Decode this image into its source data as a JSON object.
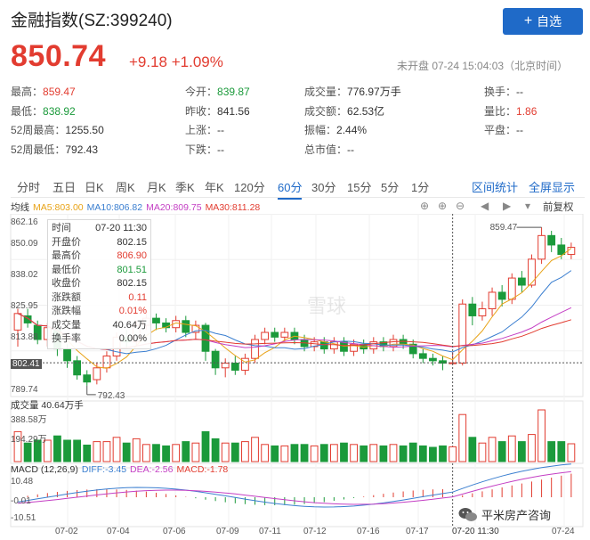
{
  "header": {
    "title": "金融指数(SZ:399240)",
    "add_button": "自选",
    "price": "850.74",
    "change": "+9.18 +1.09%",
    "status": "未开盘 07-24 15:04:03（北京时间）"
  },
  "stats": [
    [
      {
        "label": "最高：",
        "value": "859.47",
        "tone": "up"
      },
      {
        "label": "今开：",
        "value": "839.87",
        "tone": "down"
      },
      {
        "label": "成交量：",
        "value": "776.97万手",
        "tone": ""
      },
      {
        "label": "换手：",
        "value": "--",
        "tone": ""
      }
    ],
    [
      {
        "label": "最低：",
        "value": "838.92",
        "tone": "down"
      },
      {
        "label": "昨收：",
        "value": "841.56",
        "tone": ""
      },
      {
        "label": "成交额：",
        "value": "62.53亿",
        "tone": ""
      },
      {
        "label": "量比：",
        "value": "1.86",
        "tone": "up"
      }
    ],
    [
      {
        "label": "52周最高：",
        "value": "1255.50",
        "tone": ""
      },
      {
        "label": "上涨：",
        "value": "--",
        "tone": ""
      },
      {
        "label": "振幅：",
        "value": "2.44%",
        "tone": ""
      },
      {
        "label": "平盘：",
        "value": "--",
        "tone": ""
      }
    ],
    [
      {
        "label": "52周最低：",
        "value": "792.43",
        "tone": ""
      },
      {
        "label": "下跌：",
        "value": "--",
        "tone": ""
      },
      {
        "label": "总市值：",
        "value": "--",
        "tone": ""
      },
      {
        "label": "",
        "value": "",
        "tone": ""
      }
    ]
  ],
  "tabs": [
    "分时",
    "五日",
    "日K",
    "周K",
    "月K",
    "季K",
    "年K",
    "120分",
    "60分",
    "30分",
    "15分",
    "5分",
    "1分"
  ],
  "active_tab": "60分",
  "tab_links": [
    "区间统计",
    "全屏显示"
  ],
  "ma_legend": [
    {
      "text": "均线",
      "color": "#333333"
    },
    {
      "text": "MA5:803.00",
      "color": "#e8a317"
    },
    {
      "text": "MA10:806.82",
      "color": "#3b7fd0"
    },
    {
      "text": "MA20:809.75",
      "color": "#c43fc4"
    },
    {
      "text": "MA30:811.28",
      "color": "#e23c30"
    }
  ],
  "restore_label": "前复权",
  "tooltip": [
    {
      "k": "时间",
      "v": "07-20 11:30",
      "tone": ""
    },
    {
      "k": "开盘价",
      "v": "802.15",
      "tone": ""
    },
    {
      "k": "最高价",
      "v": "806.90",
      "tone": "up"
    },
    {
      "k": "最低价",
      "v": "801.51",
      "tone": "down"
    },
    {
      "k": "收盘价",
      "v": "802.15",
      "tone": ""
    },
    {
      "k": "涨跌额",
      "v": "0.11",
      "tone": "up"
    },
    {
      "k": "涨跌幅",
      "v": "0.01%",
      "tone": "up"
    },
    {
      "k": "成交量",
      "v": "40.64万",
      "tone": ""
    },
    {
      "k": "换手率",
      "v": "0.00%",
      "tone": ""
    }
  ],
  "watermark": "雪球",
  "price_axis": [
    "862.16",
    "850.09",
    "838.02",
    "825.95",
    "813.88",
    "802.41",
    "789.74"
  ],
  "annotations": {
    "high": "859.47",
    "low": "792.43"
  },
  "volume": {
    "label": "成交量 40.64万手",
    "axis": [
      "388.58万",
      "194.29万"
    ]
  },
  "macd": {
    "legend": [
      {
        "text": "MACD (12,26,9)",
        "color": "#333333"
      },
      {
        "text": "DIFF:-3.45",
        "color": "#3b7fd0"
      },
      {
        "text": "DEA:-2.56",
        "color": "#c43fc4"
      },
      {
        "text": "MACD:-1.78",
        "color": "#e23c30"
      }
    ],
    "axis": [
      "10.48",
      "-0.01",
      "-10.51"
    ]
  },
  "x_labels": [
    "07-02",
    "07-04",
    "07-06",
    "07-09",
    "07-11",
    "07-12",
    "07-16",
    "07-17",
    "07-20 11:30",
    "07-24"
  ],
  "wechat_label": "平米房产咨询",
  "colors": {
    "up": "#e23c30",
    "down": "#1b9a3b",
    "accent": "#1f6ac8"
  },
  "chart_data": {
    "type": "candlestick",
    "y_range": [
      789.74,
      862.16
    ],
    "candles": [
      [
        816,
        823,
        809,
        825
      ],
      [
        822,
        819,
        817,
        825
      ],
      [
        818,
        812,
        810,
        820
      ],
      [
        812,
        817,
        809,
        819
      ],
      [
        816,
        808,
        805,
        818
      ],
      [
        808,
        803,
        800,
        810
      ],
      [
        803,
        797,
        795,
        805
      ],
      [
        797,
        794,
        792.43,
        799
      ],
      [
        795,
        800,
        793,
        802
      ],
      [
        800,
        805,
        798,
        807
      ],
      [
        805,
        813,
        803,
        815
      ],
      [
        813,
        811,
        808,
        816
      ],
      [
        811,
        818,
        809,
        820
      ],
      [
        818,
        821,
        816,
        823
      ],
      [
        821,
        819,
        816,
        823
      ],
      [
        819,
        817,
        815,
        821
      ],
      [
        817,
        820,
        815,
        822
      ],
      [
        820,
        815,
        813,
        822
      ],
      [
        815,
        818,
        812,
        820
      ],
      [
        818,
        807,
        803,
        819
      ],
      [
        807,
        800,
        797,
        808
      ],
      [
        800,
        802,
        796,
        804
      ],
      [
        802,
        799,
        797,
        805
      ],
      [
        799,
        804,
        797,
        806
      ],
      [
        804,
        812,
        802,
        814
      ],
      [
        812,
        815,
        810,
        817
      ],
      [
        815,
        813,
        811,
        817
      ],
      [
        813,
        815,
        811,
        817
      ],
      [
        815,
        812,
        810,
        817
      ],
      [
        812,
        809,
        807,
        814
      ],
      [
        809,
        811,
        807,
        813
      ],
      [
        811,
        808,
        806,
        813
      ],
      [
        808,
        811,
        806,
        813
      ],
      [
        811,
        807,
        805,
        813
      ],
      [
        807,
        810,
        805,
        812
      ],
      [
        810,
        808,
        806,
        812
      ],
      [
        808,
        811,
        806,
        813
      ],
      [
        811,
        809,
        807,
        813
      ],
      [
        809,
        812,
        807,
        814
      ],
      [
        812,
        810,
        808,
        814
      ],
      [
        810,
        806,
        804,
        812
      ],
      [
        806,
        804,
        802,
        808
      ],
      [
        804,
        803,
        801,
        806
      ],
      [
        803,
        802,
        799,
        805
      ],
      [
        802.15,
        802.15,
        801.51,
        806.9
      ],
      [
        802,
        827,
        801,
        829
      ],
      [
        827,
        822,
        818,
        830
      ],
      [
        822,
        825,
        820,
        828
      ],
      [
        825,
        832,
        822,
        834
      ],
      [
        832,
        829,
        826,
        835
      ],
      [
        829,
        838,
        827,
        840
      ],
      [
        838,
        835,
        832,
        841
      ],
      [
        835,
        846,
        834,
        848
      ],
      [
        846,
        856,
        844,
        859.47
      ],
      [
        856,
        852,
        849,
        858
      ],
      [
        852,
        848,
        846,
        855
      ],
      [
        848,
        851,
        846,
        853
      ]
    ]
  }
}
